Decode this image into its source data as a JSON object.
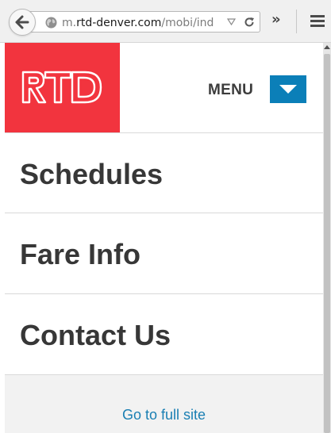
{
  "browser": {
    "url_prefix": "m.",
    "url_domain": "rtd-denver.com",
    "url_path": "/mobi/ind",
    "icons": {
      "back": "arrow-left-icon",
      "site_identity": "globe-icon",
      "history_dropdown": "triangle-down-icon",
      "reload": "reload-icon",
      "overflow": "double-chevron-icon",
      "menu": "hamburger-icon"
    },
    "overflow_glyph": "»"
  },
  "header": {
    "logo_text": "RTD",
    "menu_label": "MENU"
  },
  "nav": {
    "items": [
      {
        "label": "Schedules"
      },
      {
        "label": "Fare Info"
      },
      {
        "label": "Contact Us"
      }
    ]
  },
  "footer": {
    "full_site_link": "Go to full site"
  },
  "colors": {
    "brand_red": "#f2343e",
    "menu_blue": "#0b7fb8",
    "link_blue": "#1a7fb3",
    "nav_text": "#373737"
  }
}
